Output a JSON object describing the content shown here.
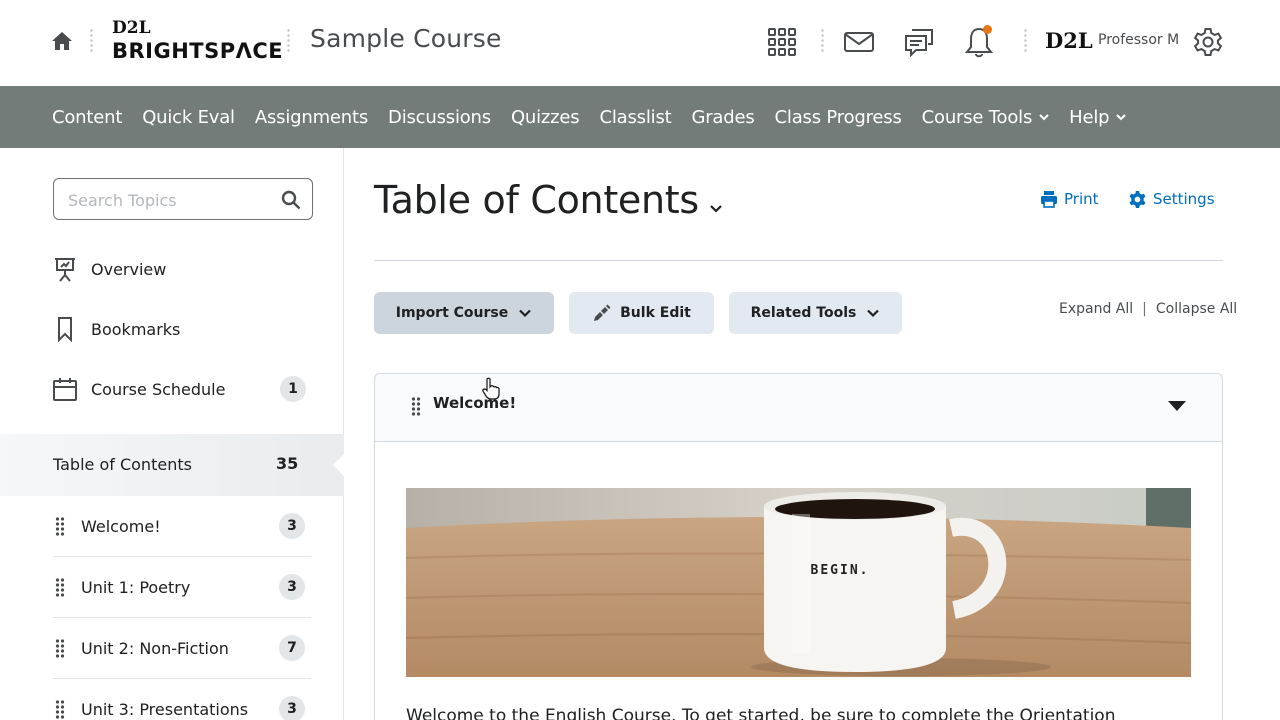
{
  "header": {
    "logo_top": "D2L",
    "logo_bottom": "BRIGHTSPΛCE",
    "course_title": "Sample Course",
    "user_logo": "D2L",
    "user_name": "Professor M",
    "notification_color": "#e87511"
  },
  "nav": {
    "items": [
      "Content",
      "Quick Eval",
      "Assignments",
      "Discussions",
      "Quizzes",
      "Classlist",
      "Grades",
      "Class Progress"
    ],
    "dropdowns": [
      "Course Tools",
      "Help"
    ],
    "background": "#747c79"
  },
  "sidebar": {
    "search_placeholder": "Search Topics",
    "links": [
      {
        "label": "Overview",
        "icon": "presentation-icon"
      },
      {
        "label": "Bookmarks",
        "icon": "bookmark-icon"
      },
      {
        "label": "Course Schedule",
        "icon": "calendar-icon",
        "count": "1"
      }
    ],
    "toc": {
      "label": "Table of Contents",
      "count": "35"
    },
    "modules": [
      {
        "label": "Welcome!",
        "count": "3"
      },
      {
        "label": "Unit 1: Poetry",
        "count": "3"
      },
      {
        "label": "Unit 2: Non-Fiction",
        "count": "7"
      },
      {
        "label": "Unit 3: Presentations",
        "count": "3"
      }
    ]
  },
  "main": {
    "title": "Table of Contents",
    "print_label": "Print",
    "settings_label": "Settings",
    "link_color": "#006fbf",
    "buttons": {
      "import_course": "Import Course",
      "bulk_edit": "Bulk Edit",
      "related_tools": "Related Tools"
    },
    "expand_all": "Expand All",
    "collapse_all": "Collapse All",
    "unit": {
      "title": "Welcome!",
      "mug_text": "BEGIN.",
      "intro_text": "Welcome to the English Course. To get started, be sure to complete the Orientation"
    }
  }
}
